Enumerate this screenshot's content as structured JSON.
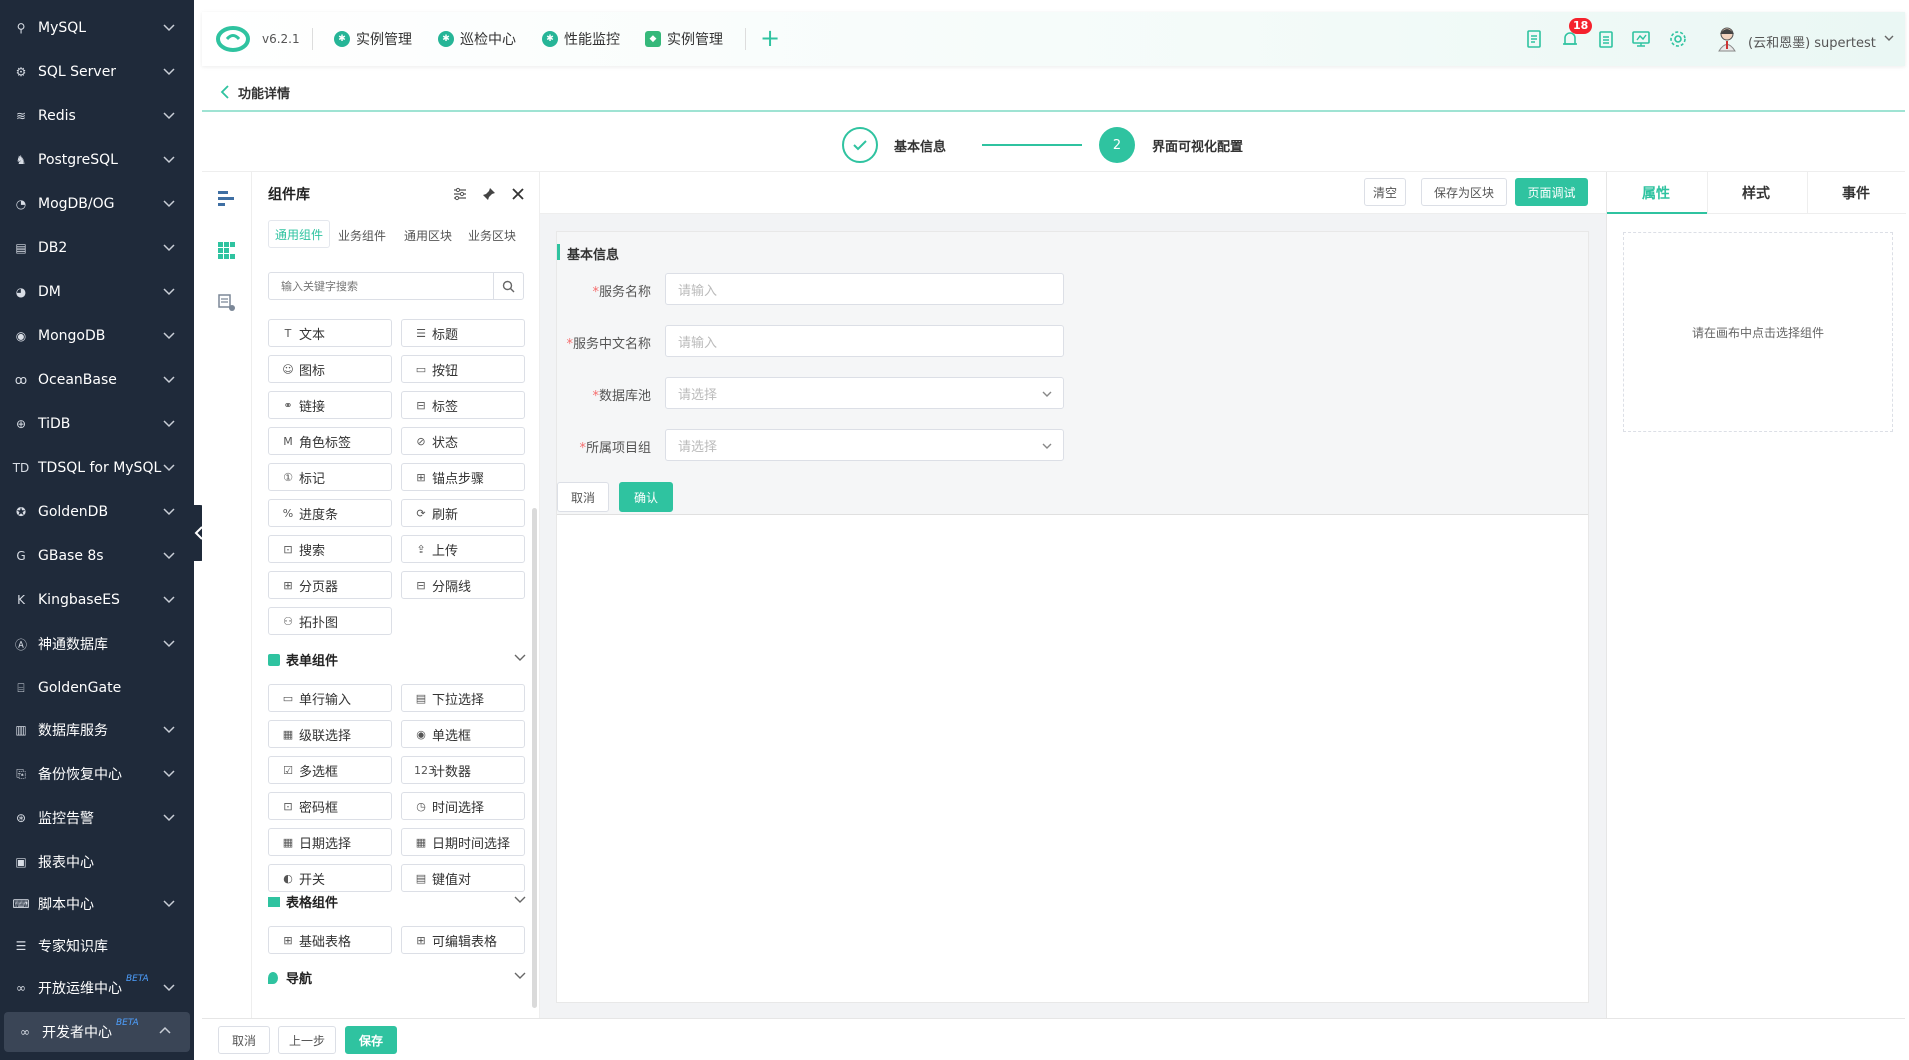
{
  "sidebar": {
    "items": [
      {
        "label": "MySQL",
        "icon": "mysql-icon"
      },
      {
        "label": "SQL Server",
        "icon": "sqlserver-icon"
      },
      {
        "label": "Redis",
        "icon": "redis-icon"
      },
      {
        "label": "PostgreSQL",
        "icon": "postgresql-icon"
      },
      {
        "label": "MogDB/OG",
        "icon": "mogdb-icon"
      },
      {
        "label": "DB2",
        "icon": "db2-icon"
      },
      {
        "label": "DM",
        "icon": "dm-icon"
      },
      {
        "label": "MongoDB",
        "icon": "mongodb-icon"
      },
      {
        "label": "OceanBase",
        "icon": "oceanbase-icon"
      },
      {
        "label": "TiDB",
        "icon": "tidb-icon"
      },
      {
        "label": "TDSQL for MySQL",
        "icon": "tdsql-icon"
      },
      {
        "label": "GoldenDB",
        "icon": "goldendb-icon"
      },
      {
        "label": "GBase 8s",
        "icon": "gbase-icon"
      },
      {
        "label": "KingbaseES",
        "icon": "kingbase-icon"
      },
      {
        "label": "神通数据库",
        "icon": "shentong-icon"
      },
      {
        "label": "GoldenGate",
        "icon": "goldengate-icon"
      },
      {
        "label": "数据库服务",
        "icon": "chart-icon"
      },
      {
        "label": "备份恢复中心",
        "icon": "backup-icon"
      },
      {
        "label": "监控告警",
        "icon": "monitor-icon"
      },
      {
        "label": "报表中心",
        "icon": "report-icon"
      },
      {
        "label": "脚本中心",
        "icon": "script-icon"
      },
      {
        "label": "专家知识库",
        "icon": "book-icon"
      },
      {
        "label": "开放运维中心",
        "icon": "infinity-icon",
        "badge": "BETA"
      },
      {
        "label": "开发者中心",
        "icon": "infinity-icon",
        "badge": "BETA"
      }
    ]
  },
  "topbar": {
    "version": "v6.2.1",
    "menus": [
      "实例管理",
      "巡检中心",
      "性能监控",
      "实例管理"
    ],
    "notification_count": "18",
    "user": "(云和恩墨) supertest"
  },
  "breadcrumb": {
    "title": "功能详情"
  },
  "steps": [
    {
      "label": "基本信息",
      "state": "done"
    },
    {
      "number": "2",
      "label": "界面可视化配置",
      "state": "active"
    }
  ],
  "library": {
    "title": "组件库",
    "tabs": [
      "通用组件",
      "业务组件",
      "通用区块",
      "业务区块"
    ],
    "search_placeholder": "输入关键字搜索",
    "general": [
      "文本",
      "标题",
      "图标",
      "按钮",
      "链接",
      "标签",
      "角色标签",
      "状态",
      "标记",
      "锚点步骤",
      "进度条",
      "刷新",
      "搜索",
      "上传",
      "分页器",
      "分隔线",
      "拓扑图"
    ],
    "form_section": "表单组件",
    "form": [
      "单行输入",
      "下拉选择",
      "级联选择",
      "单选框",
      "多选框",
      "计数器",
      "密码框",
      "时间选择",
      "日期选择",
      "日期时间选择",
      "开关",
      "键值对"
    ],
    "table_section": "表格组件",
    "table": [
      "基础表格",
      "可编辑表格"
    ],
    "nav_section": "导航"
  },
  "canvas_toolbar": {
    "clear": "清空",
    "save_block": "保存为区块",
    "debug": "页面调试"
  },
  "form": {
    "section_title": "基本信息",
    "fields": [
      {
        "label": "服务名称",
        "placeholder": "请输入"
      },
      {
        "label": "服务中文名称",
        "placeholder": "请输入"
      },
      {
        "label": "数据库池",
        "placeholder": "请选择"
      },
      {
        "label": "所属项目组",
        "placeholder": "请选择"
      }
    ],
    "cancel": "取消",
    "confirm": "确认"
  },
  "props_panel": {
    "tabs": [
      "属性",
      "样式",
      "事件"
    ],
    "empty_hint": "请在画布中点击选择组件"
  },
  "footer": {
    "cancel": "取消",
    "prev": "上一步",
    "save": "保存"
  },
  "colors": {
    "accent": "#2fc3a0",
    "sidebar_bg": "#1f2a3a",
    "badge": "#f5222d"
  }
}
